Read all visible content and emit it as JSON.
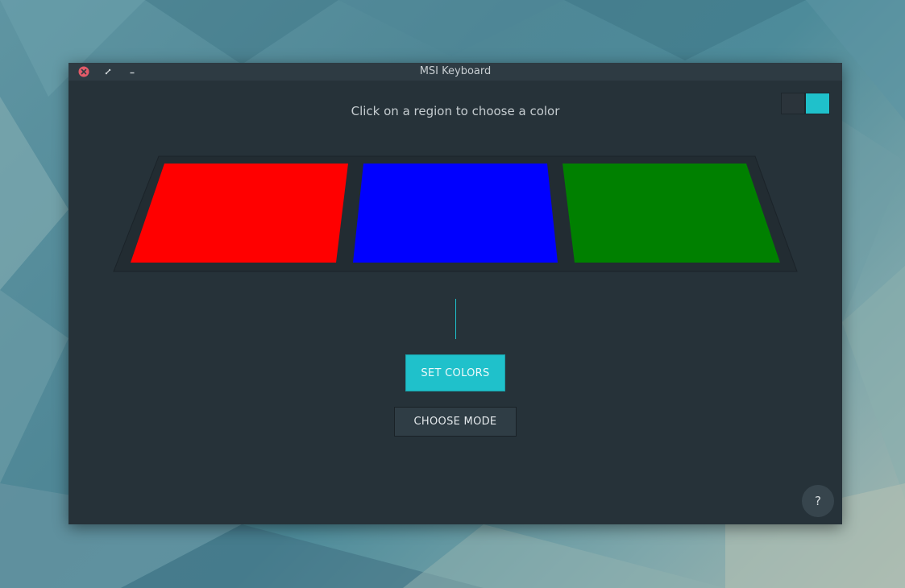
{
  "window": {
    "title": "MSI Keyboard"
  },
  "instruction": "Click on a region to choose a color",
  "color_toggle": {
    "left_color": "#2b343b",
    "right_color": "#1fc1cb"
  },
  "regions": [
    {
      "name": "left",
      "color": "#ff0000"
    },
    {
      "name": "middle",
      "color": "#0000ff"
    },
    {
      "name": "right",
      "color": "#008000"
    }
  ],
  "buttons": {
    "set_colors": "SET COLORS",
    "choose_mode": "CHOOSE MODE",
    "help": "?"
  },
  "titlebar_icons": [
    "close-icon",
    "restore-icon",
    "minimize-icon"
  ],
  "accent_color": "#1fc1cb"
}
